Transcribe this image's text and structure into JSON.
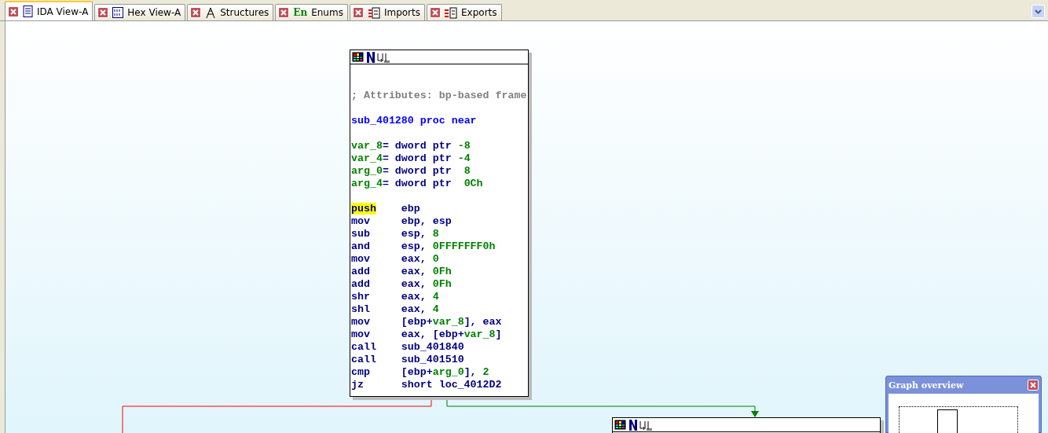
{
  "tabs": [
    {
      "label": "IDA View-A",
      "selected": true,
      "kind": "listing"
    },
    {
      "label": "Hex View-A",
      "selected": false,
      "kind": "hex"
    },
    {
      "label": "Structures",
      "selected": false,
      "kind": "structures"
    },
    {
      "label": "Enums",
      "selected": false,
      "kind": "enums",
      "badge": "En"
    },
    {
      "label": "Imports",
      "selected": false,
      "kind": "imports"
    },
    {
      "label": "Exports",
      "selected": false,
      "kind": "exports"
    }
  ],
  "main_node": {
    "blocks": [
      {
        "lines": [
          {
            "segments": [
              {
                "text": "; Attributes: bp-based frame",
                "kind": "comment"
              }
            ]
          }
        ]
      },
      {
        "lines": [
          {
            "segments": [
              {
                "text": "sub_401280 proc near",
                "kind": "name"
              }
            ]
          }
        ]
      },
      {
        "lines": [
          {
            "segments": [
              {
                "text": "var_8",
                "kind": "var"
              },
              {
                "text": "= dword ptr ",
                "kind": "op"
              },
              {
                "text": "-8",
                "kind": "num"
              }
            ]
          },
          {
            "segments": [
              {
                "text": "var_4",
                "kind": "var"
              },
              {
                "text": "= dword ptr ",
                "kind": "op"
              },
              {
                "text": "-4",
                "kind": "num"
              }
            ]
          },
          {
            "segments": [
              {
                "text": "arg_0",
                "kind": "var"
              },
              {
                "text": "= dword ptr  ",
                "kind": "op"
              },
              {
                "text": "8",
                "kind": "num"
              }
            ]
          },
          {
            "segments": [
              {
                "text": "arg_4",
                "kind": "var"
              },
              {
                "text": "= dword ptr  ",
                "kind": "op"
              },
              {
                "text": "0Ch",
                "kind": "num"
              }
            ]
          }
        ]
      },
      {
        "lines": [
          {
            "segments": [
              {
                "text": "push",
                "kind": "mnemonic",
                "highlighted": true
              },
              {
                "text": "ebp",
                "kind": "op"
              }
            ]
          },
          {
            "segments": [
              {
                "text": "mov",
                "kind": "mnemonic",
                "highlighted": false
              },
              {
                "text": "ebp, esp",
                "kind": "op"
              }
            ]
          },
          {
            "segments": [
              {
                "text": "sub",
                "kind": "mnemonic",
                "highlighted": false
              },
              {
                "text": "esp, ",
                "kind": "op"
              },
              {
                "text": "8",
                "kind": "num"
              }
            ]
          },
          {
            "segments": [
              {
                "text": "and",
                "kind": "mnemonic",
                "highlighted": false
              },
              {
                "text": "esp, ",
                "kind": "op"
              },
              {
                "text": "0FFFFFFF0h",
                "kind": "num"
              }
            ]
          },
          {
            "segments": [
              {
                "text": "mov",
                "kind": "mnemonic",
                "highlighted": false
              },
              {
                "text": "eax, ",
                "kind": "op"
              },
              {
                "text": "0",
                "kind": "num"
              }
            ]
          },
          {
            "segments": [
              {
                "text": "add",
                "kind": "mnemonic",
                "highlighted": false
              },
              {
                "text": "eax, ",
                "kind": "op"
              },
              {
                "text": "0Fh",
                "kind": "num"
              }
            ]
          },
          {
            "segments": [
              {
                "text": "add",
                "kind": "mnemonic",
                "highlighted": false
              },
              {
                "text": "eax, ",
                "kind": "op"
              },
              {
                "text": "0Fh",
                "kind": "num"
              }
            ]
          },
          {
            "segments": [
              {
                "text": "shr",
                "kind": "mnemonic",
                "highlighted": false
              },
              {
                "text": "eax, ",
                "kind": "op"
              },
              {
                "text": "4",
                "kind": "num"
              }
            ]
          },
          {
            "segments": [
              {
                "text": "shl",
                "kind": "mnemonic",
                "highlighted": false
              },
              {
                "text": "eax, ",
                "kind": "op"
              },
              {
                "text": "4",
                "kind": "num"
              }
            ]
          },
          {
            "segments": [
              {
                "text": "mov",
                "kind": "mnemonic",
                "highlighted": false
              },
              {
                "text": "[ebp+",
                "kind": "op"
              },
              {
                "text": "var_8",
                "kind": "var"
              },
              {
                "text": "], eax",
                "kind": "op"
              }
            ]
          },
          {
            "segments": [
              {
                "text": "mov",
                "kind": "mnemonic",
                "highlighted": false
              },
              {
                "text": "eax, [ebp+",
                "kind": "op"
              },
              {
                "text": "var_8",
                "kind": "var"
              },
              {
                "text": "]",
                "kind": "op"
              }
            ]
          },
          {
            "segments": [
              {
                "text": "call",
                "kind": "mnemonic",
                "highlighted": false
              },
              {
                "text": "sub_401840",
                "kind": "op"
              }
            ]
          },
          {
            "segments": [
              {
                "text": "call",
                "kind": "mnemonic",
                "highlighted": false
              },
              {
                "text": "sub_401510",
                "kind": "op"
              }
            ]
          },
          {
            "segments": [
              {
                "text": "cmp",
                "kind": "mnemonic",
                "highlighted": false
              },
              {
                "text": "[ebp+",
                "kind": "op"
              },
              {
                "text": "arg_0",
                "kind": "var"
              },
              {
                "text": "], ",
                "kind": "op"
              },
              {
                "text": "2",
                "kind": "num"
              }
            ]
          },
          {
            "segments": [
              {
                "text": "jz",
                "kind": "mnemonic",
                "highlighted": false
              },
              {
                "text": "short loc_4012D2",
                "kind": "op"
              }
            ]
          }
        ]
      }
    ]
  },
  "overview": {
    "title": "Graph overview"
  }
}
